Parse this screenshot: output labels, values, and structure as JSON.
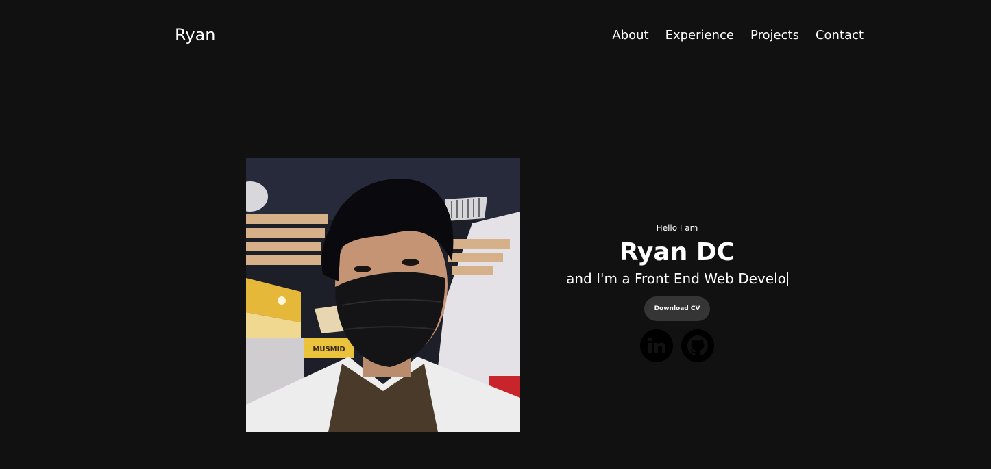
{
  "nav": {
    "logo": "Ryan",
    "links": [
      "About",
      "Experience",
      "Projects",
      "Contact"
    ]
  },
  "hero": {
    "greeting": "Hello I am",
    "name": "Ryan DC",
    "role_text": "and I'm a Front End Web Develo",
    "download_label": "Download CV"
  },
  "icons": {
    "linkedin": "linkedin-icon",
    "github": "github-icon"
  },
  "colors": {
    "background": "#111111",
    "text": "#ffffff",
    "button": "#353535",
    "social_icon": "#000000"
  }
}
